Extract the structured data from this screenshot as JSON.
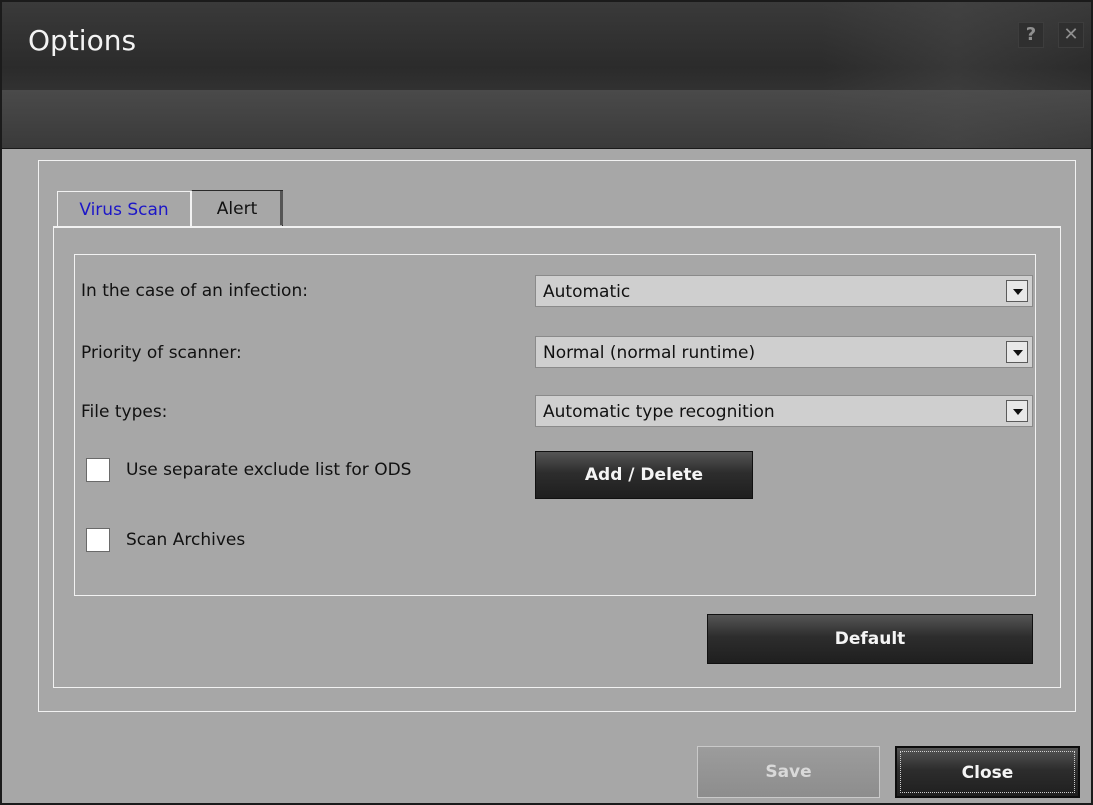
{
  "window": {
    "title": "Options"
  },
  "header_buttons": {
    "help": "?",
    "close": "✕"
  },
  "tabs": [
    {
      "label": "Virus Scan",
      "active": true
    },
    {
      "label": "Alert",
      "active": false
    }
  ],
  "virus_scan": {
    "infection_label": "In the case of an infection:",
    "infection_value": "Automatic",
    "priority_label": "Priority of scanner:",
    "priority_value": "Normal (normal runtime)",
    "file_types_label": "File types:",
    "file_types_value": "Automatic type recognition",
    "exclude_checkbox_label": "Use separate exclude list for ODS",
    "exclude_checked": false,
    "add_delete_label": "Add / Delete",
    "scan_archives_label": "Scan Archives",
    "scan_archives_checked": false,
    "default_label": "Default"
  },
  "footer": {
    "save_label": "Save",
    "close_label": "Close"
  },
  "colors": {
    "active_tab_text": "#1c16c8",
    "panel_bg": "#a7a7a7",
    "header_bg": "#2b2b2b"
  }
}
